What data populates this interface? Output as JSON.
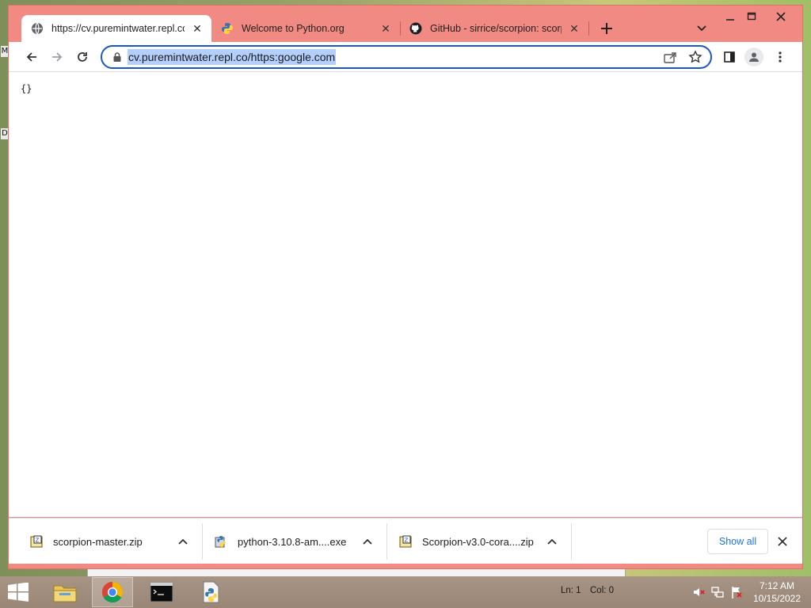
{
  "desktop": {
    "edge_glyph_top": "M",
    "edge_glyph_mid": "D"
  },
  "browser": {
    "tabs": [
      {
        "title": "https://cv.puremintwater.repl.co/",
        "icon": "globe-icon",
        "active": true
      },
      {
        "title": "Welcome to Python.org",
        "icon": "python-logo-icon",
        "active": false
      },
      {
        "title": "GitHub - sirrice/scorpion: scorpio",
        "icon": "github-icon",
        "active": false
      }
    ],
    "address_bar": {
      "url": "cv.puremintwater.repl.co/https:google.com"
    },
    "page": {
      "body_text": "{}"
    },
    "downloads": {
      "items": [
        {
          "name": "scorpion-master.zip",
          "icon": "zip-archive-icon"
        },
        {
          "name": "python-3.10.8-am....exe",
          "icon": "python-installer-icon"
        },
        {
          "name": "Scorpion-v3.0-cora....zip",
          "icon": "zip-archive-icon"
        }
      ],
      "show_all_label": "Show all"
    }
  },
  "taskbar": {
    "status_line": "Ln: 1",
    "status_col": "Col: 0",
    "clock_time": "7:12 AM",
    "clock_date": "10/15/2022"
  },
  "colors": {
    "window_frame": "#f28a84",
    "address_focus": "#1a56c8",
    "url_selection": "#b4cffb",
    "show_all_text": "#1a73e8"
  }
}
